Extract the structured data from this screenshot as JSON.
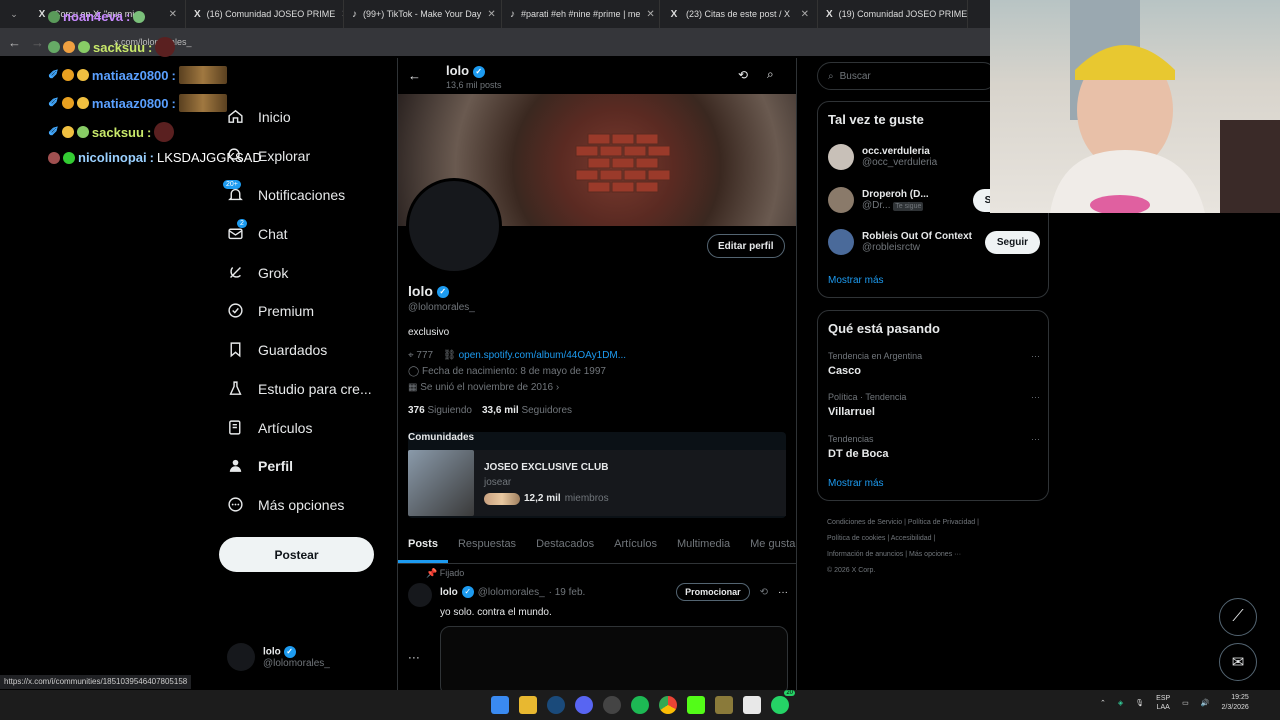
{
  "browser": {
    "tabs": [
      {
        "title": "Corcu en X: \"que mi",
        "icon": "x-logo"
      },
      {
        "title": "(16) Comunidad JOSEO PRIME",
        "icon": "x-logo"
      },
      {
        "title": "(99+) TikTok - Make Your Day",
        "icon": "tiktok-logo"
      },
      {
        "title": "#parati #eh #nine #prime | me",
        "icon": "tiktok-logo"
      },
      {
        "title": "(23) Citas de este post / X",
        "icon": "x-logo"
      },
      {
        "title": "(19) Comunidad JOSEO PRIME",
        "icon": "x-logo"
      }
    ],
    "address": "x.com/lolomorales_",
    "status_url": "https://x.com/i/communities/1851039546407805158"
  },
  "stream_chat": [
    {
      "user": "noan4eva",
      "color": "#c88aff",
      "message": ""
    },
    {
      "user": "sacksuu",
      "color": "#c8e86a",
      "message": ""
    },
    {
      "user": "matiaaz0800",
      "color": "#5aa0ff",
      "message": ""
    },
    {
      "user": "matiaaz0800",
      "color": "#5aa0ff",
      "message": ""
    },
    {
      "user": "sacksuu",
      "color": "#c8e86a",
      "message": ""
    },
    {
      "user": "nicolinopai",
      "color": "#9ad0ff",
      "message": "LKSDAJGGKSAD"
    }
  ],
  "nav": {
    "items": [
      {
        "label": "Inicio",
        "icon": "home-icon"
      },
      {
        "label": "Explorar",
        "icon": "search-icon"
      },
      {
        "label": "Notificaciones",
        "icon": "bell-icon",
        "badge": "20+"
      },
      {
        "label": "Chat",
        "icon": "mail-icon",
        "badge": "2"
      },
      {
        "label": "Grok",
        "icon": "grok-icon"
      },
      {
        "label": "Premium",
        "icon": "premium-icon"
      },
      {
        "label": "Guardados",
        "icon": "bookmark-icon"
      },
      {
        "label": "Estudio para cre...",
        "icon": "studio-icon"
      },
      {
        "label": "Artículos",
        "icon": "article-icon"
      },
      {
        "label": "Perfil",
        "icon": "person-icon"
      },
      {
        "label": "Más opciones",
        "icon": "more-circle-icon"
      }
    ],
    "post_label": "Postear",
    "account_name": "lolo",
    "account_handle": "@lolomorales_"
  },
  "profile": {
    "header_name": "lolo",
    "header_posts": "13,6 mil posts",
    "name": "lolo",
    "handle": "@lolomorales_",
    "edit_label": "Editar perfil",
    "bio": "exclusivo",
    "location": "777",
    "link": "open.spotify.com/album/44OAy1DM...",
    "birthday": "Fecha de nacimiento: 8 de mayo de 1997",
    "joined": "Se unió el noviembre de 2016",
    "following_count": "376",
    "following_label": "Siguiendo",
    "followers_count": "33,6 mil",
    "followers_label": "Seguidores",
    "communities_label": "Comunidades",
    "community_name": "JOSEO EXCLUSIVE CLUB",
    "community_sub": "josear",
    "community_members": "12,2 mil",
    "community_members_label": "miembros",
    "tabs": [
      "Posts",
      "Respuestas",
      "Destacados",
      "Artículos",
      "Multimedia",
      "Me gusta"
    ]
  },
  "post": {
    "pinned_label": "Fijado",
    "name": "lolo",
    "handle": "@lolomorales_",
    "date": "· 19 feb.",
    "promote_label": "Promocionar",
    "text": "yo solo. contra el mundo."
  },
  "sidebar": {
    "search_placeholder": "Buscar",
    "suggest_title": "Tal vez te guste",
    "suggestions": [
      {
        "name": "occ.verduleria",
        "handle": "@occ_verduleria",
        "button": "",
        "follows_you": ""
      },
      {
        "name": "Droperoh (D...",
        "handle": "@Dr...",
        "button": "Seguir tú",
        "follows_you": "Te sigue"
      },
      {
        "name": "Robleis Out Of Context",
        "handle": "@robleisrctw",
        "button": "Seguir",
        "follows_you": ""
      }
    ],
    "show_more": "Mostrar más",
    "trends_title": "Qué está pasando",
    "trends": [
      {
        "context": "Tendencia en Argentina",
        "name": "Casco"
      },
      {
        "context": "Política · Tendencia",
        "name": "Villarruel"
      },
      {
        "context": "Tendencias",
        "name": "DT de Boca"
      }
    ],
    "trends_more": "Mostrar más",
    "footer": [
      "Condiciones de Servicio",
      "|",
      "Política de Privacidad",
      "|",
      "Política de cookies",
      "|",
      "Accesibilidad",
      "|",
      "Información de anuncios",
      "|",
      "Más opciones ···",
      "© 2026 X Corp."
    ]
  },
  "taskbar": {
    "lang": "ESP",
    "lang2": "LAA",
    "time": "19:25",
    "date": "2/3/2026",
    "whatsapp_badge": "20"
  }
}
